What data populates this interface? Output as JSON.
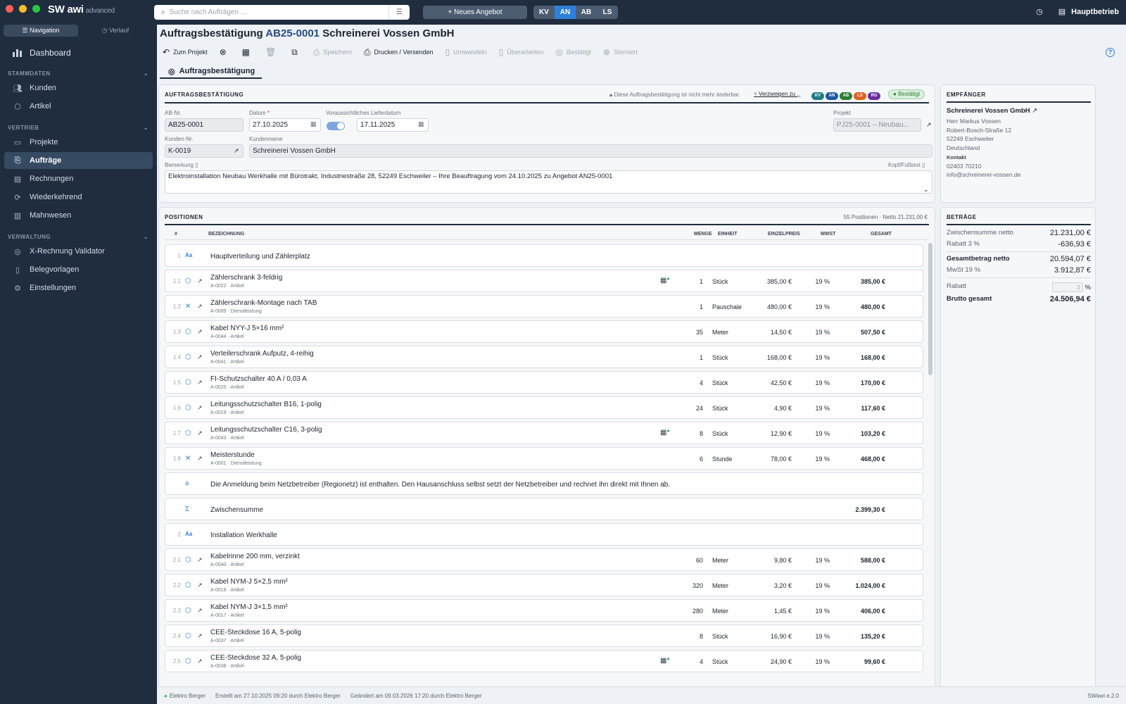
{
  "app": {
    "brand_a": "SW",
    "brand_b": "awi",
    "edition": "advanced",
    "version": "SWawi e.2.0"
  },
  "nav_toggle": {
    "navigation": "Navigation",
    "history": "Verlauf"
  },
  "sidebar": {
    "dashboard": "Dashboard",
    "sections": [
      {
        "title": "STAMMDATEN",
        "items": [
          {
            "label": "Kunden",
            "icon": "users-icon"
          },
          {
            "label": "Artikel",
            "icon": "box-icon"
          }
        ]
      },
      {
        "title": "VERTRIEB",
        "items": [
          {
            "label": "Projekte",
            "icon": "folder-icon"
          },
          {
            "label": "Aufträge",
            "icon": "orders-icon"
          },
          {
            "label": "Rechnungen",
            "icon": "invoice-icon"
          },
          {
            "label": "Wiederkehrend",
            "icon": "repeat-icon"
          },
          {
            "label": "Mahnwesen",
            "icon": "dunning-icon"
          }
        ]
      },
      {
        "title": "VERWALTUNG",
        "items": [
          {
            "label": "X-Rechnung Validator",
            "icon": "check-icon"
          },
          {
            "label": "Belegvorlagen",
            "icon": "template-icon"
          },
          {
            "label": "Einstellungen",
            "icon": "gear-icon"
          }
        ]
      }
    ]
  },
  "topbar": {
    "search_placeholder": "Suche nach Aufträgen ...",
    "new_offer": "Neues Angebot",
    "doc_types": [
      "KV",
      "AN",
      "AB",
      "LS"
    ],
    "active_doc_type": "AN",
    "company": "Hauptbetrieb"
  },
  "document": {
    "title_prefix": "Auftragsbestätigung",
    "number": "AB25-0001",
    "customer": "Schreinerei Vossen GmbH"
  },
  "toolbar": {
    "back": "Zum Projekt",
    "save": "Speichern",
    "print": "Drucken / Versenden",
    "convert": "Umwandeln",
    "revise": "Überarbeiten",
    "confirm": "Bestätigt",
    "cancel": "Storniert"
  },
  "tab_label": "Auftragsbestätigung",
  "header_panel": {
    "title": "AUFTRAGSBESTÄTIGUNG",
    "lock_note": "Diese Auftragsbestätigung ist nicht mehr änderbar.",
    "branch": "Verzweigen zu",
    "status": "Bestätigt",
    "pills": [
      {
        "label": "KV",
        "color": "#1d7d86"
      },
      {
        "label": "AN",
        "color": "#1f5aa6"
      },
      {
        "label": "AB",
        "color": "#2e7d32"
      },
      {
        "label": "LS",
        "color": "#e0601f"
      },
      {
        "label": "RG",
        "color": "#6a2aa0"
      }
    ],
    "ab_nr_label": "AB-Nr.",
    "ab_nr": "AB25-0001",
    "date_label": "Datum",
    "date": "27.10.2025",
    "delivery_label": "Voraussichtliches Lieferdatum",
    "delivery": "17.11.2025",
    "project_label": "Projekt",
    "project": "PJ25-0001 – Neubau...",
    "cust_nr_label": "Kunden-Nr.",
    "cust_nr": "K-0019",
    "cust_name_label": "Kundenname",
    "cust_name": "Schreinerei Vossen GmbH",
    "remark_label": "Bemerkung",
    "footer_label": "Kopf/Fußtext",
    "remark": "Elektroinstallation Neubau Werkhalle mit Bürotrakt, Industriestraße 28, 52249 Eschweiler – Ihre Beauftragung vom 24.10.2025 zu Angebot AN25-0001"
  },
  "positions": {
    "title": "POSITIONEN",
    "summary": "55 Positionen · Netto 21.231,00 €",
    "headers": {
      "num": "#",
      "name": "BEZEICHNUNG",
      "qty": "MENGE",
      "unit": "EINHEIT",
      "price": "EINZELPREIS",
      "vat": "MWST",
      "total": "GESAMT"
    },
    "rows": [
      {
        "kind": "group",
        "num": "1",
        "name": "Hauptverteilung und Zählerplatz"
      },
      {
        "kind": "item",
        "icon": "box-icon",
        "num": "1.1",
        "name": "Zählerschrank 3-feldrig",
        "sub": "A-0022 · Artikel",
        "flag": true,
        "qty": "1",
        "unit": "Stück",
        "price": "385,00 €",
        "vat": "19 %",
        "total": "385,00 €"
      },
      {
        "kind": "item",
        "icon": "tools-icon",
        "num": "1.2",
        "name": "Zählerschrank-Montage nach TAB",
        "sub": "A-0009 · Dienstleistung",
        "flag": false,
        "qty": "1",
        "unit": "Pauschale",
        "price": "480,00 €",
        "vat": "19 %",
        "total": "480,00 €"
      },
      {
        "kind": "item",
        "icon": "box-icon",
        "num": "1.3",
        "name": "Kabel NYY-J 5×16 mm²",
        "sub": "A-0044 · Artikel",
        "flag": false,
        "qty": "35",
        "unit": "Meter",
        "price": "14,50 €",
        "vat": "19 %",
        "total": "507,50 €"
      },
      {
        "kind": "item",
        "icon": "box-icon",
        "num": "1.4",
        "name": "Verteilerschrank Aufputz, 4-reihig",
        "sub": "A-0041 · Artikel",
        "flag": false,
        "qty": "1",
        "unit": "Stück",
        "price": "168,00 €",
        "vat": "19 %",
        "total": "168,00 €"
      },
      {
        "kind": "item",
        "icon": "box-icon",
        "num": "1.5",
        "name": "FI-Schutzschalter 40 A / 0,03 A",
        "sub": "A-0020 · Artikel",
        "flag": false,
        "qty": "4",
        "unit": "Stück",
        "price": "42,50 €",
        "vat": "19 %",
        "total": "170,00 €"
      },
      {
        "kind": "item",
        "icon": "box-icon",
        "num": "1.6",
        "name": "Leitungsschutzschalter B16, 1-polig",
        "sub": "A-0019 · Artikel",
        "flag": false,
        "qty": "24",
        "unit": "Stück",
        "price": "4,90 €",
        "vat": "19 %",
        "total": "117,60 €"
      },
      {
        "kind": "item",
        "icon": "box-icon",
        "num": "1.7",
        "name": "Leitungsschutzschalter C16, 3-polig",
        "sub": "A-0043 · Artikel",
        "flag": true,
        "qty": "8",
        "unit": "Stück",
        "price": "12,90 €",
        "vat": "19 %",
        "total": "103,20 €"
      },
      {
        "kind": "item",
        "icon": "tools-icon",
        "num": "1.8",
        "name": "Meisterstunde",
        "sub": "A-0001 · Dienstleistung",
        "flag": false,
        "qty": "6",
        "unit": "Stunde",
        "price": "78,00 €",
        "vat": "19 %",
        "total": "468,00 €"
      },
      {
        "kind": "text",
        "name": "Die Anmeldung beim Netzbetreiber (Regionetz) ist enthalten. Den Hausanschluss selbst setzt der Netzbetreiber und rechnet ihn direkt mit Ihnen ab."
      },
      {
        "kind": "sum",
        "name": "Zwischensumme",
        "total": "2.399,30 €"
      },
      {
        "kind": "group",
        "num": "2",
        "name": "Installation Werkhalle"
      },
      {
        "kind": "item",
        "icon": "box-icon",
        "num": "2.1",
        "name": "Kabelrinne 200 mm, verzinkt",
        "sub": "A-0040 · Artikel",
        "flag": false,
        "qty": "60",
        "unit": "Meter",
        "price": "9,80 €",
        "vat": "19 %",
        "total": "588,00 €"
      },
      {
        "kind": "item",
        "icon": "box-icon",
        "num": "2.2",
        "name": "Kabel NYM-J 5×2,5 mm²",
        "sub": "A-0018 · Artikel",
        "flag": false,
        "qty": "320",
        "unit": "Meter",
        "price": "3,20 €",
        "vat": "19 %",
        "total": "1.024,00 €"
      },
      {
        "kind": "item",
        "icon": "box-icon",
        "num": "2.3",
        "name": "Kabel NYM-J 3×1,5 mm²",
        "sub": "A-0017 · Artikel",
        "flag": false,
        "qty": "280",
        "unit": "Meter",
        "price": "1,45 €",
        "vat": "19 %",
        "total": "406,00 €"
      },
      {
        "kind": "item",
        "icon": "box-icon",
        "num": "2.4",
        "name": "CEE-Steckdose 16 A, 5-polig",
        "sub": "A-0037 · Artikel",
        "flag": false,
        "qty": "8",
        "unit": "Stück",
        "price": "16,90 €",
        "vat": "19 %",
        "total": "135,20 €"
      },
      {
        "kind": "item",
        "icon": "box-icon",
        "num": "2.5",
        "name": "CEE-Steckdose 32 A, 5-polig",
        "sub": "A-0038 · Artikel",
        "flag": true,
        "qty": "4",
        "unit": "Stück",
        "price": "24,90 €",
        "vat": "19 %",
        "total": "99,60 €"
      }
    ]
  },
  "recipient": {
    "title": "EMPFÄNGER",
    "company": "Schreinerei Vossen GmbH",
    "lines": [
      "Herr Markus Vossen",
      "Robert-Bosch-Straße 12",
      "52249 Eschweiler",
      "Deutschland"
    ],
    "contact_label": "Kontakt",
    "phone": "02403 70210",
    "email": "info@schreinerei-vossen.de"
  },
  "amounts": {
    "title": "BETRÄGE",
    "subtotal_label": "Zwischensumme netto",
    "subtotal": "21.231,00 €",
    "discount_label": "Rabatt 3 %",
    "discount": "-636,93 €",
    "net_label": "Gesamtbetrag netto",
    "net": "20.594,07 €",
    "vat_label": "MwSt 19 %",
    "vat": "3.912,87 €",
    "rabatt_label": "Rabatt",
    "rabatt_placeholder": "3",
    "rabatt_unit": "%",
    "gross_label": "Brutto gesamt",
    "gross": "24.506,94 €"
  },
  "statusbar": {
    "user": "Elektro Berger",
    "created": "Erstellt am 27.10.2025 09:20 durch Elektro Berger",
    "changed": "Geändert am 09.03.2026 17:20 durch Elektro Berger"
  }
}
